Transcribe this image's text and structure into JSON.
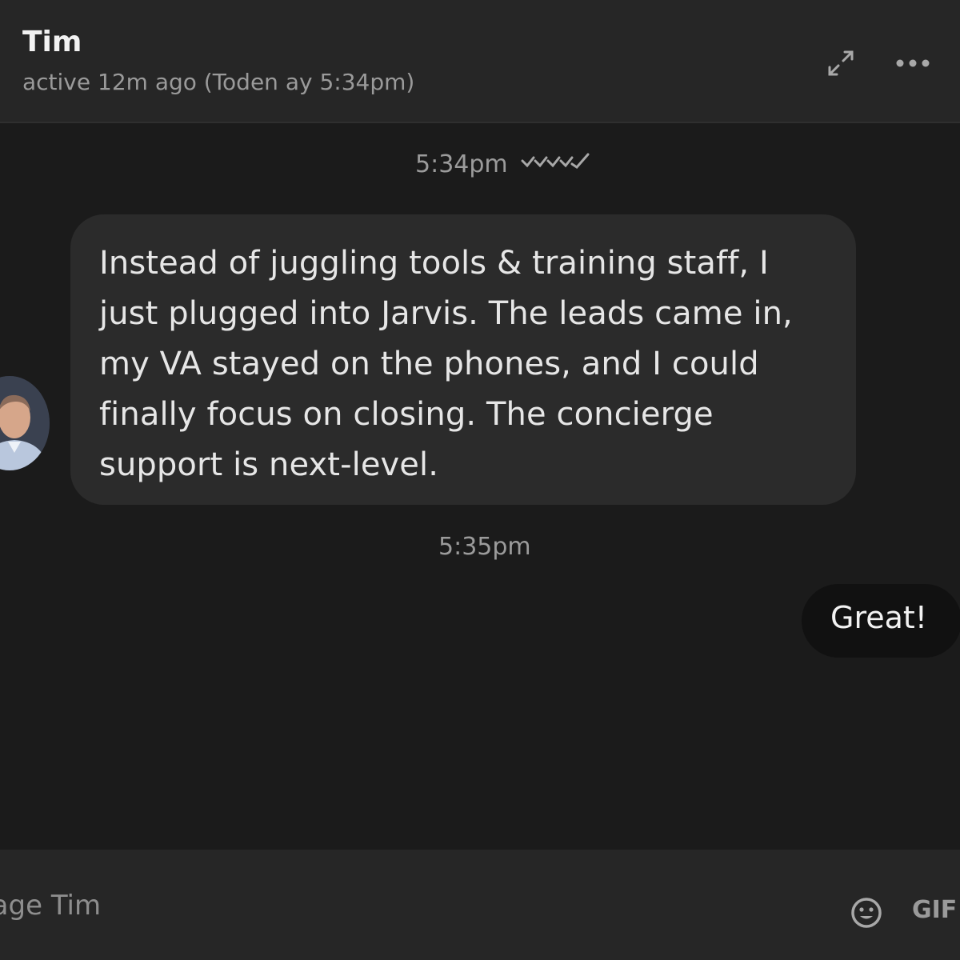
{
  "header": {
    "name": "Tim",
    "status": "active 12m ago (Toden ay 5:34pm)"
  },
  "icons": {
    "expand": "expand-icon",
    "more": "more-icon",
    "read_receipt": "read-receipt-icon",
    "emoji": "emoji-icon",
    "avatar": "avatar-photo"
  },
  "messages": [
    {
      "timestamp": "5:34pm",
      "direction": "incoming",
      "text": "Instead of juggling tools & training staff, I just plugged into Jarvis. The leads came in, my VA stayed on the phones, and I could finally focus on closing. The concierge support is next-level."
    },
    {
      "timestamp": "5:35pm",
      "direction": "outgoing",
      "text": "Great!"
    }
  ],
  "composer": {
    "placeholder": "Message Tim",
    "gif_label": "GIF"
  },
  "colors": {
    "background": "#1b1b1b",
    "header": "#262626",
    "incoming_bubble": "#2b2b2b",
    "outgoing_bubble": "#111111",
    "muted_text": "#9b9b9b"
  }
}
